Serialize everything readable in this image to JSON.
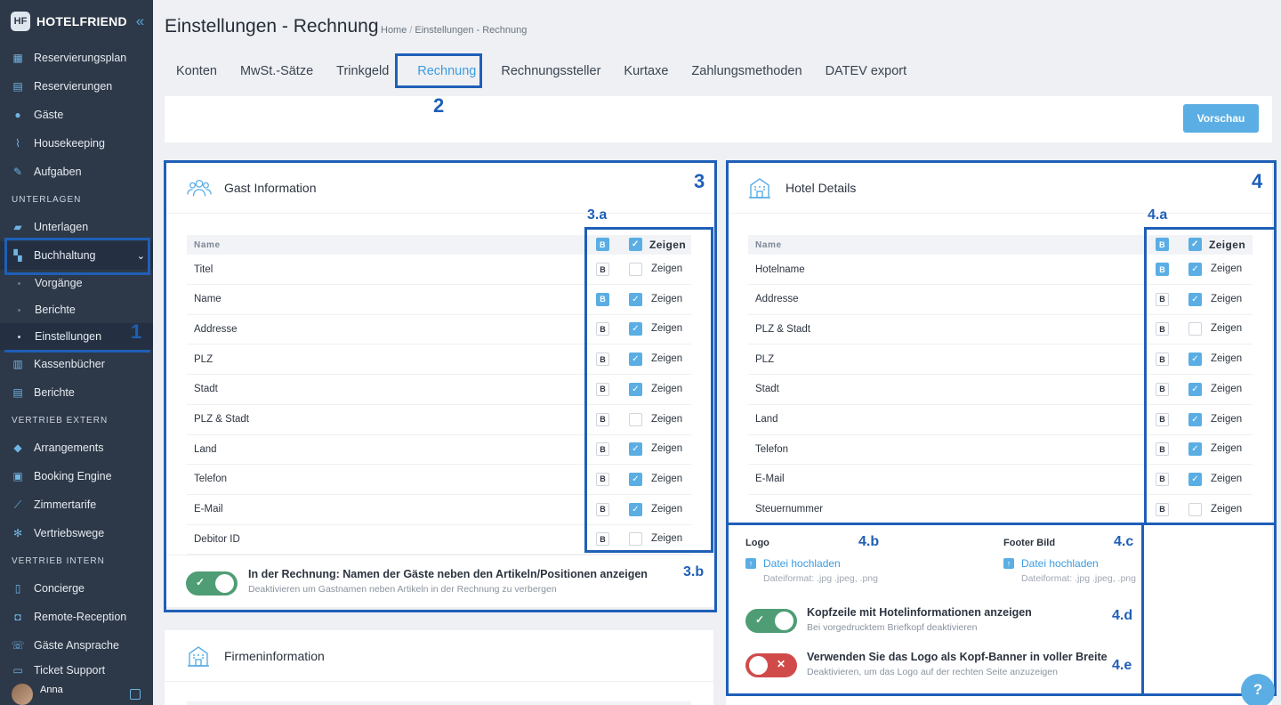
{
  "app": {
    "name": "HOTELFRIEND",
    "collapse_icon": "chevron-left-icon"
  },
  "sidebar": {
    "items_top": [
      {
        "label": "Reservierungsplan",
        "icon": "calendar-icon"
      },
      {
        "label": "Reservierungen",
        "icon": "document-icon"
      },
      {
        "label": "Gäste",
        "icon": "person-icon"
      },
      {
        "label": "Housekeeping",
        "icon": "broom-icon"
      },
      {
        "label": "Aufgaben",
        "icon": "wrench-icon"
      }
    ],
    "section_unterlagen": "UNTERLAGEN",
    "unterlagen": "Unterlagen",
    "buchhaltung": "Buchhaltung",
    "buchhaltung_sub": [
      "Vorgänge",
      "Berichte",
      "Einstellungen"
    ],
    "kassenbuecher": "Kassenbücher",
    "berichte": "Berichte",
    "section_extern": "VERTRIEB EXTERN",
    "extern": [
      "Arrangements",
      "Booking Engine",
      "Zimmertarife",
      "Vertriebswege"
    ],
    "section_intern": "VERTRIEB INTERN",
    "intern": [
      "Concierge",
      "Remote-Reception",
      "Gäste Ansprache"
    ],
    "ticket": "Ticket Support",
    "user": "Anna"
  },
  "header": {
    "title": "Einstellungen - Rechnung",
    "breadcrumb": [
      "Home",
      "Einstellungen - Rechnung"
    ],
    "tabs": [
      "Konten",
      "MwSt.-Sätze",
      "Trinkgeld",
      "Rechnung",
      "Rechnungssteller",
      "Kurtaxe",
      "Zahlungsmethoden",
      "DATEV export"
    ],
    "active_tab": "Rechnung",
    "preview_button": "Vorschau"
  },
  "gast": {
    "title": "Gast Information",
    "col_name": "Name",
    "col_bold": "B",
    "col_show": "Zeigen",
    "rows": [
      {
        "name": "Titel",
        "bold": false,
        "show": false
      },
      {
        "name": "Name",
        "bold": true,
        "show": true
      },
      {
        "name": "Addresse",
        "bold": false,
        "show": true
      },
      {
        "name": "PLZ",
        "bold": false,
        "show": true
      },
      {
        "name": "Stadt",
        "bold": false,
        "show": true
      },
      {
        "name": "PLZ & Stadt",
        "bold": false,
        "show": false
      },
      {
        "name": "Land",
        "bold": false,
        "show": true
      },
      {
        "name": "Telefon",
        "bold": false,
        "show": true
      },
      {
        "name": "E-Mail",
        "bold": false,
        "show": true
      },
      {
        "name": "Debitor ID",
        "bold": false,
        "show": false
      }
    ],
    "toggle_title": "In der Rechnung: Namen der Gäste neben den Artikeln/Positionen anzeigen",
    "toggle_desc": "Deaktivieren um Gastnamen neben Artikeln in der Rechnung zu verbergen",
    "toggle_on": true
  },
  "hotel": {
    "title": "Hotel Details",
    "col_name": "Name",
    "col_bold": "B",
    "col_show": "Zeigen",
    "rows": [
      {
        "name": "Hotelname",
        "bold": true,
        "show": true
      },
      {
        "name": "Addresse",
        "bold": false,
        "show": true
      },
      {
        "name": "PLZ & Stadt",
        "bold": false,
        "show": false
      },
      {
        "name": "PLZ",
        "bold": false,
        "show": true
      },
      {
        "name": "Stadt",
        "bold": false,
        "show": true
      },
      {
        "name": "Land",
        "bold": false,
        "show": true
      },
      {
        "name": "Telefon",
        "bold": false,
        "show": true
      },
      {
        "name": "E-Mail",
        "bold": false,
        "show": true
      },
      {
        "name": "Steuernummer",
        "bold": false,
        "show": false
      }
    ],
    "logo_label": "Logo",
    "footer_label": "Footer Bild",
    "upload_text": "Datei hochladen",
    "upload_hint": "Dateiformat: .jpg .jpeg, .png",
    "toggle1_title": "Kopfzeile mit Hotelinformationen anzeigen",
    "toggle1_desc": "Bei vorgedrucktem Briefkopf deaktivieren",
    "toggle1_on": true,
    "toggle2_title": "Verwenden Sie das Logo als Kopf-Banner in voller Breite",
    "toggle2_desc": "Deaktivieren, um das Logo auf der rechten Seite anzuzeigen",
    "toggle2_on": false
  },
  "firma": {
    "title": "Firmeninformation"
  },
  "annotations": [
    "1",
    "2",
    "3",
    "3.a",
    "3.b",
    "4",
    "4.a",
    "4.b",
    "4.c",
    "4.d",
    "4.e"
  ],
  "help": "?",
  "colors": {
    "sidebar": "#2d3848",
    "accent": "#5aaee4",
    "annotation": "#1f5fb7",
    "toggle_on": "#4e9d74",
    "toggle_off": "#d14a4a"
  }
}
